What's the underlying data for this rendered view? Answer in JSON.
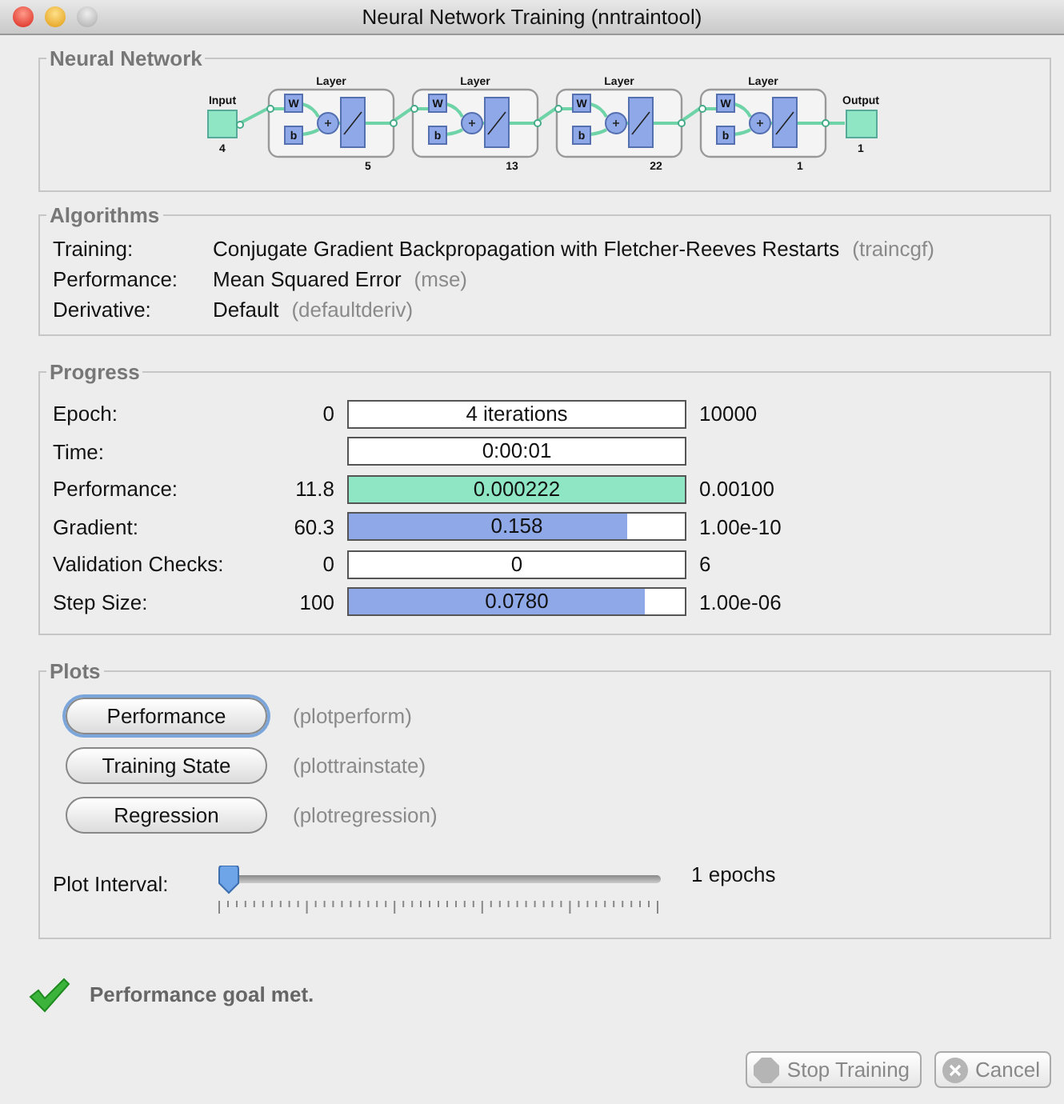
{
  "window": {
    "title": "Neural Network Training (nntraintool)"
  },
  "network": {
    "title": "Neural Network",
    "input": {
      "label": "Input",
      "size": "4"
    },
    "layers": [
      {
        "label": "Layer",
        "weight": "W",
        "bias": "b",
        "size": "5"
      },
      {
        "label": "Layer",
        "weight": "W",
        "bias": "b",
        "size": "13"
      },
      {
        "label": "Layer",
        "weight": "W",
        "bias": "b",
        "size": "22"
      },
      {
        "label": "Layer",
        "weight": "W",
        "bias": "b",
        "size": "1"
      }
    ],
    "output": {
      "label": "Output",
      "size": "1"
    }
  },
  "algorithms": {
    "title": "Algorithms",
    "rows": [
      {
        "label": "Training:",
        "value": "Conjugate Gradient Backpropagation with Fletcher-Reeves Restarts",
        "function": "(traincgf)"
      },
      {
        "label": "Performance:",
        "value": "Mean Squared Error",
        "function": "(mse)"
      },
      {
        "label": "Derivative:",
        "value": "Default",
        "function": "(defaultderiv)"
      }
    ]
  },
  "progress": {
    "title": "Progress",
    "rows": [
      {
        "label": "Epoch:",
        "start": "0",
        "reading": "4 iterations",
        "end": "10000"
      },
      {
        "label": "Time:",
        "reading": "0:00:01"
      },
      {
        "label": "Performance:",
        "start": "11.8",
        "reading": "0.000222",
        "level": 1,
        "color": "#8ee6c4",
        "end": "0.00100"
      },
      {
        "label": "Gradient:",
        "start": "60.3",
        "reading": "0.158",
        "level": 0.83,
        "color": "#8fa8e8",
        "end": "1.00e-10"
      },
      {
        "label": "Validation Checks:",
        "start": "0",
        "reading": "0",
        "end": "6"
      },
      {
        "label": "Step Size:",
        "start": "100",
        "reading": "0.0780",
        "level": 0.88,
        "color": "#8fa8e8",
        "end": "1.00e-06"
      }
    ]
  },
  "plots": {
    "title": "Plots",
    "buttons": [
      {
        "label": "Performance",
        "function": "(plotperform)",
        "selected": true
      },
      {
        "label": "Training State",
        "function": "(plottrainstate)",
        "selected": false
      },
      {
        "label": "Regression",
        "function": "(plotregression)",
        "selected": false
      }
    ],
    "interval": {
      "label": "Plot Interval:",
      "level": 0,
      "reading": "1 epochs"
    }
  },
  "status": {
    "message": "Performance goal met."
  },
  "buttons": [
    {
      "label": "Stop Training",
      "kind": "stop",
      "disabled": true
    },
    {
      "label": "Cancel",
      "kind": "cancel",
      "disabled": true
    }
  ]
}
